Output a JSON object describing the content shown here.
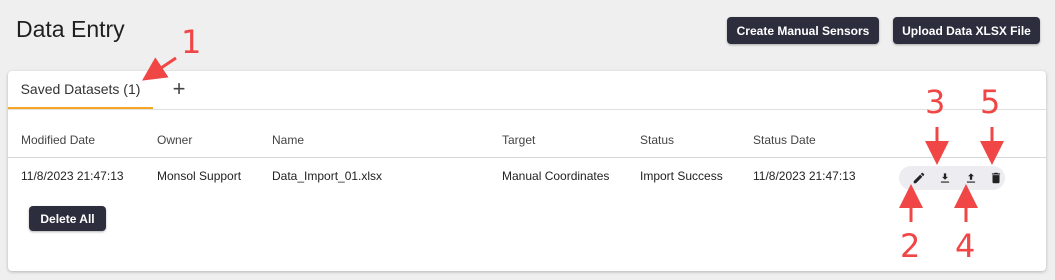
{
  "header": {
    "title": "Data Entry",
    "create_manual_sensors_label": "Create Manual Sensors",
    "upload_xlsx_label": "Upload Data XLSX File"
  },
  "tabs": {
    "active_label": "Saved Datasets (1)",
    "add_glyph": "+"
  },
  "table": {
    "columns": [
      "Modified Date",
      "Owner",
      "Name",
      "Target",
      "Status",
      "Status Date"
    ],
    "rows": [
      [
        "11/8/2023 21:47:13",
        "Monsol Support",
        "Data_Import_01.xlsx",
        "Manual Coordinates",
        "Import Success",
        "11/8/2023 21:47:13"
      ]
    ],
    "row_actions": [
      "edit-icon",
      "download-icon",
      "upload-icon",
      "trash-icon"
    ]
  },
  "footer": {
    "delete_all_label": "Delete All"
  },
  "callouts": [
    "1",
    "2",
    "3",
    "4",
    "5"
  ],
  "colors": {
    "accent_tab": "#f5a623",
    "dark_button": "#2c2e3e",
    "callout": "#f04646",
    "background": "#efefef"
  }
}
